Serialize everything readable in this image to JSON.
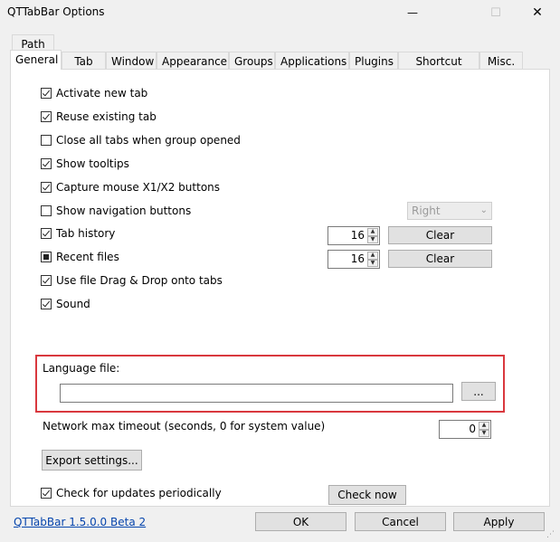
{
  "window": {
    "title": "QTTabBar Options",
    "minimize_glyph": "—",
    "maximize_glyph": "☐",
    "close_glyph": "✕"
  },
  "tabs_row1": [
    {
      "label": "Path"
    }
  ],
  "tabs_row2": [
    {
      "label": "General",
      "active": true
    },
    {
      "label": "Tab"
    },
    {
      "label": "Window"
    },
    {
      "label": "Appearance"
    },
    {
      "label": "Groups"
    },
    {
      "label": "Applications"
    },
    {
      "label": "Plugins"
    },
    {
      "label": "Shortcut Keys"
    },
    {
      "label": "Misc."
    }
  ],
  "options": [
    {
      "label": "Activate new tab",
      "state": "checked"
    },
    {
      "label": "Reuse existing tab",
      "state": "checked"
    },
    {
      "label": "Close all tabs when group opened",
      "state": "unchecked"
    },
    {
      "label": "Show tooltips",
      "state": "checked"
    },
    {
      "label": "Capture mouse X1/X2 buttons",
      "state": "checked"
    },
    {
      "label": "Show navigation buttons",
      "state": "unchecked"
    },
    {
      "label": "Tab history",
      "state": "checked"
    },
    {
      "label": "Recent files",
      "state": "indeterminate"
    },
    {
      "label": "Use file Drag & Drop onto tabs",
      "state": "checked"
    },
    {
      "label": "Sound",
      "state": "checked"
    }
  ],
  "nav_position_select": {
    "value": "Right"
  },
  "tab_history": {
    "value": "16",
    "clear_label": "Clear"
  },
  "recent_files": {
    "value": "16",
    "clear_label": "Clear"
  },
  "language": {
    "label": "Language file:",
    "value": "",
    "browse_label": "..."
  },
  "network": {
    "label": "Network max timeout (seconds, 0 for system value)",
    "value": "0"
  },
  "export_label": "Export settings...",
  "updates": {
    "label": "Check for updates periodically",
    "state": "checked",
    "check_now_label": "Check now"
  },
  "footer": {
    "version_link": "QTTabBar 1.5.0.0 Beta 2",
    "ok": "OK",
    "cancel": "Cancel",
    "apply": "Apply"
  }
}
